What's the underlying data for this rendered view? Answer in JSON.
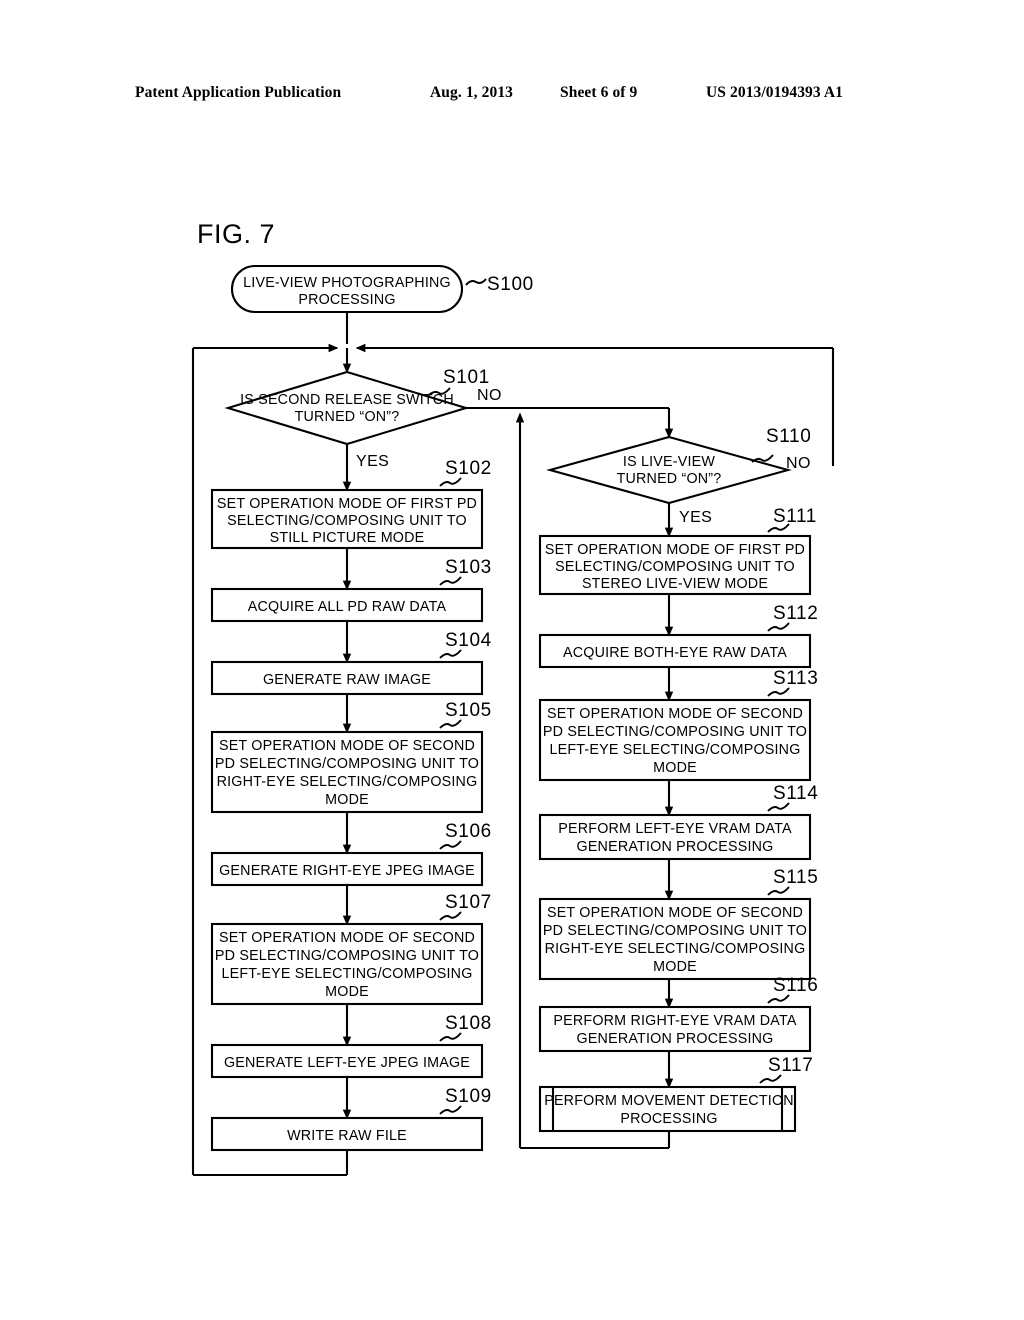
{
  "header": {
    "publication": "Patent Application Publication",
    "date": "Aug. 1, 2013",
    "sheet": "Sheet 6 of 9",
    "patent_number": "US 2013/0194393 A1"
  },
  "figure": {
    "label": "FIG. 7"
  },
  "chart_data": {
    "type": "diagram",
    "diagram_kind": "flowchart",
    "title": "FIG. 7",
    "nodes": [
      {
        "id": "S100",
        "step": "S100",
        "shape": "terminator",
        "lines": [
          "LIVE-VIEW PHOTOGRAPHING",
          "PROCESSING"
        ]
      },
      {
        "id": "S101",
        "step": "S101",
        "shape": "decision",
        "lines": [
          "IS SECOND RELEASE SWITCH",
          "TURNED “ON”?"
        ],
        "branches": {
          "yes": "YES",
          "no": "NO"
        }
      },
      {
        "id": "S102",
        "step": "S102",
        "shape": "process",
        "lines": [
          "SET OPERATION MODE OF FIRST PD",
          "SELECTING/COMPOSING UNIT TO",
          "STILL PICTURE MODE"
        ]
      },
      {
        "id": "S103",
        "step": "S103",
        "shape": "process",
        "lines": [
          "ACQUIRE ALL PD RAW DATA"
        ]
      },
      {
        "id": "S104",
        "step": "S104",
        "shape": "process",
        "lines": [
          "GENERATE RAW IMAGE"
        ]
      },
      {
        "id": "S105",
        "step": "S105",
        "shape": "process",
        "lines": [
          "SET OPERATION MODE OF SECOND",
          "PD SELECTING/COMPOSING UNIT TO",
          "RIGHT-EYE SELECTING/COMPOSING",
          "MODE"
        ]
      },
      {
        "id": "S106",
        "step": "S106",
        "shape": "process",
        "lines": [
          "GENERATE RIGHT-EYE JPEG IMAGE"
        ]
      },
      {
        "id": "S107",
        "step": "S107",
        "shape": "process",
        "lines": [
          "SET OPERATION MODE OF SECOND",
          "PD SELECTING/COMPOSING UNIT TO",
          "LEFT-EYE SELECTING/COMPOSING",
          "MODE"
        ]
      },
      {
        "id": "S108",
        "step": "S108",
        "shape": "process",
        "lines": [
          "GENERATE LEFT-EYE JPEG IMAGE"
        ]
      },
      {
        "id": "S109",
        "step": "S109",
        "shape": "process",
        "lines": [
          "WRITE RAW FILE"
        ]
      },
      {
        "id": "S110",
        "step": "S110",
        "shape": "decision",
        "lines": [
          "IS LIVE-VIEW",
          "TURNED “ON”?"
        ],
        "branches": {
          "yes": "YES",
          "no": "NO"
        }
      },
      {
        "id": "S111",
        "step": "S111",
        "shape": "process",
        "lines": [
          "SET OPERATION MODE OF FIRST PD",
          "SELECTING/COMPOSING UNIT TO",
          "STEREO LIVE-VIEW MODE"
        ]
      },
      {
        "id": "S112",
        "step": "S112",
        "shape": "process",
        "lines": [
          "ACQUIRE BOTH-EYE RAW DATA"
        ]
      },
      {
        "id": "S113",
        "step": "S113",
        "shape": "process",
        "lines": [
          "SET OPERATION MODE OF SECOND",
          "PD SELECTING/COMPOSING UNIT TO",
          "LEFT-EYE SELECTING/COMPOSING",
          "MODE"
        ]
      },
      {
        "id": "S114",
        "step": "S114",
        "shape": "process",
        "lines": [
          "PERFORM LEFT-EYE VRAM DATA",
          "GENERATION PROCESSING"
        ]
      },
      {
        "id": "S115",
        "step": "S115",
        "shape": "process",
        "lines": [
          "SET OPERATION MODE OF SECOND",
          "PD SELECTING/COMPOSING UNIT TO",
          "RIGHT-EYE SELECTING/COMPOSING",
          "MODE"
        ]
      },
      {
        "id": "S116",
        "step": "S116",
        "shape": "process",
        "lines": [
          "PERFORM RIGHT-EYE VRAM DATA",
          "GENERATION PROCESSING"
        ]
      },
      {
        "id": "S117",
        "step": "S117",
        "shape": "predefined-process",
        "lines": [
          "PERFORM MOVEMENT DETECTION",
          "PROCESSING"
        ]
      }
    ],
    "edges": [
      {
        "from": "S100",
        "to": "S101",
        "label": ""
      },
      {
        "from": "S101",
        "to": "S102",
        "label": "YES"
      },
      {
        "from": "S101",
        "to": "S110",
        "label": "NO"
      },
      {
        "from": "S102",
        "to": "S103",
        "label": ""
      },
      {
        "from": "S103",
        "to": "S104",
        "label": ""
      },
      {
        "from": "S104",
        "to": "S105",
        "label": ""
      },
      {
        "from": "S105",
        "to": "S106",
        "label": ""
      },
      {
        "from": "S106",
        "to": "S107",
        "label": ""
      },
      {
        "from": "S107",
        "to": "S108",
        "label": ""
      },
      {
        "from": "S108",
        "to": "S109",
        "label": ""
      },
      {
        "from": "S109",
        "to": "S101",
        "label": ""
      },
      {
        "from": "S110",
        "to": "S111",
        "label": "YES"
      },
      {
        "from": "S110",
        "to": "S101",
        "label": "NO"
      },
      {
        "from": "S111",
        "to": "S112",
        "label": ""
      },
      {
        "from": "S112",
        "to": "S113",
        "label": ""
      },
      {
        "from": "S113",
        "to": "S114",
        "label": ""
      },
      {
        "from": "S114",
        "to": "S115",
        "label": ""
      },
      {
        "from": "S115",
        "to": "S116",
        "label": ""
      },
      {
        "from": "S116",
        "to": "S117",
        "label": ""
      },
      {
        "from": "S117",
        "to": "S101",
        "label": ""
      }
    ]
  }
}
